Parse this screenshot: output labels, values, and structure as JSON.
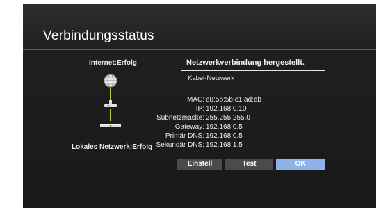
{
  "title": "Verbindungsstatus",
  "diagram": {
    "internet_status": "Internet:Erfolg",
    "local_network_status": "Lokales Netzwerk:Erfolg",
    "icons": [
      "globe-icon",
      "router-icon",
      "tv-icon"
    ]
  },
  "status": {
    "heading": "Netzwerkverbindung hergestellt.",
    "connection_type": "Kabel-Netzwerk"
  },
  "network_info": [
    {
      "label": "MAC:",
      "value": "e8:5b:5b:c1:ad:ab"
    },
    {
      "label": "IP:",
      "value": "192.168.0.10"
    },
    {
      "label": "Subnetzmaske:",
      "value": "255.255.255.0"
    },
    {
      "label": "Gateway:",
      "value": "192.168.0.5"
    },
    {
      "label": "Primär DNS:",
      "value": "192.168.0.5"
    },
    {
      "label": "Sekundär DNS:",
      "value": "192.168.1.5"
    }
  ],
  "buttons": {
    "settings_label": "Einstell",
    "test_label": "Test",
    "ok_label": "OK"
  },
  "colors": {
    "background": "#1f1f1f",
    "selected_button": "#8fb2e8",
    "button": "#4b4b4b",
    "text": "#ececec"
  }
}
